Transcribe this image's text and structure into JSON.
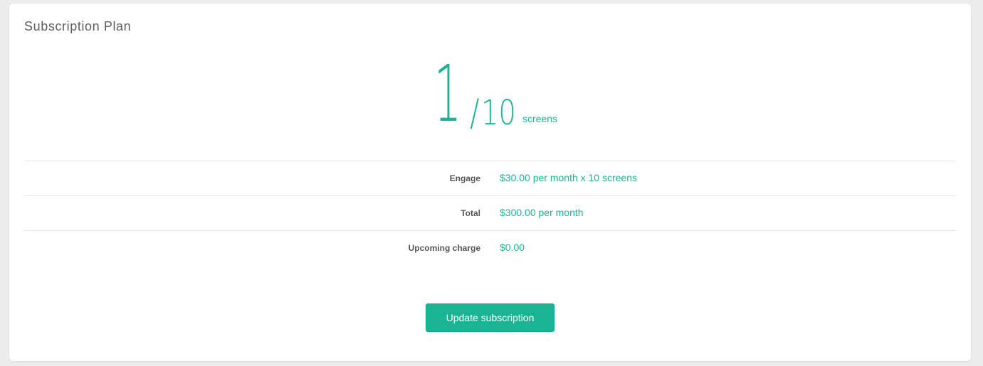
{
  "card": {
    "title": "Subscription Plan"
  },
  "usage": {
    "current": "1",
    "separator": "/",
    "total": "10",
    "unit": "screens"
  },
  "plan_rows": [
    {
      "label": "Engage",
      "value": "$30.00 per month x 10 screens"
    },
    {
      "label": "Total",
      "value": "$300.00 per month"
    },
    {
      "label": "Upcoming charge",
      "value": "$0.00"
    }
  ],
  "actions": {
    "update_label": "Update subscription"
  },
  "colors": {
    "accent": "#1ab394",
    "label": "#555555",
    "title": "#5f5f5f",
    "background": "#ececec"
  }
}
